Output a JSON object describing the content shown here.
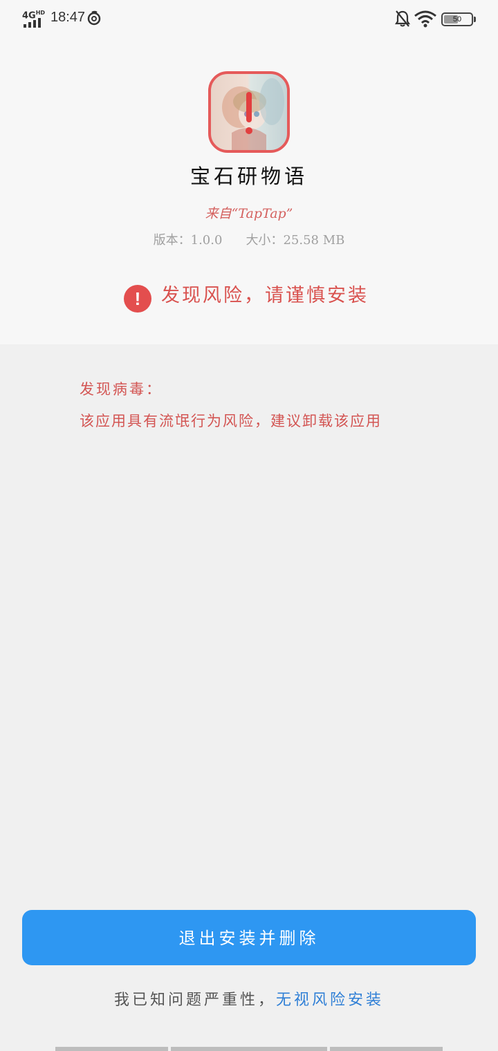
{
  "status_bar": {
    "network": "4G",
    "network_sup": "HD",
    "time": "18:47",
    "battery_level": "50"
  },
  "app": {
    "name": "宝石研物语",
    "source": "来自“TapTap”",
    "version_label": "版本：",
    "version": "1.0.0",
    "size_label": "大小：",
    "size": "25.58 MB"
  },
  "risk_banner": {
    "icon": "exclamation-circle-icon",
    "icon_glyph": "!",
    "text": "发现风险，请谨慎安装"
  },
  "virus": {
    "title": "发现病毒：",
    "description": "该应用具有流氓行为风险，建议卸载该应用"
  },
  "actions": {
    "primary_label": "退出安装并删除",
    "ignore_prefix": "我已知问题严重性，",
    "ignore_link": "无视风险安装"
  },
  "colors": {
    "accent_blue": "#2e97f2",
    "link_blue": "#2f7fd6",
    "danger_red": "#e34e4e",
    "text_red": "#d35553"
  }
}
